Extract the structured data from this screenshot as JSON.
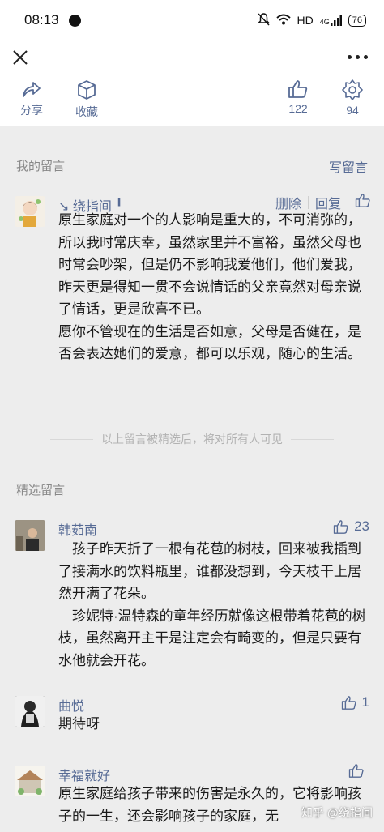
{
  "status": {
    "time": "08:13",
    "network": "HD",
    "signal": "4G",
    "battery": "76"
  },
  "actions": {
    "share": "分享",
    "collect": "收藏",
    "like_count": "122",
    "wow_count": "94"
  },
  "my_comments": {
    "header": "我的留言",
    "write": "写留言",
    "item": {
      "name": "↘ 绕指间 ╹",
      "delete": "删除",
      "reply": "回复",
      "paragraphs": [
        "原生家庭对一个的人影响是重大的，不可消弥的，所以我时常庆幸，虽然家里并不富裕，虽然父母也时常会吵架，但是仍不影响我爱他们，他们爱我，昨天更是得知一贯不会说情话的父亲竟然对母亲说了情话，更是欣喜不已。",
        "愿你不管现在的生活是否如意，父母是否健在，是否会表达她们的爱意，都可以乐观，随心的生活。"
      ]
    },
    "notice": "以上留言被精选后，将对所有人可见"
  },
  "featured": {
    "header": "精选留言",
    "items": [
      {
        "name": "韩茹南",
        "likes": "23",
        "paragraphs": [
          "孩子昨天折了一根有花苞的树枝，回来被我插到了接满水的饮料瓶里，谁都没想到，今天枝干上居然开满了花朵。",
          "珍妮特·温特森的童年经历就像这根带着花苞的树枝，虽然离开主干是注定会有畸变的，但是只要有水他就会开花。"
        ]
      },
      {
        "name": "曲悦",
        "likes": "1",
        "paragraphs": [
          "期待呀"
        ]
      },
      {
        "name": "幸福就好",
        "likes": "",
        "paragraphs": [
          "原生家庭给孩子带来的伤害是永久的，它将影响孩子的一生，还会影响孩子的家庭，无"
        ]
      }
    ]
  },
  "watermark": "知乎 @绕指间"
}
